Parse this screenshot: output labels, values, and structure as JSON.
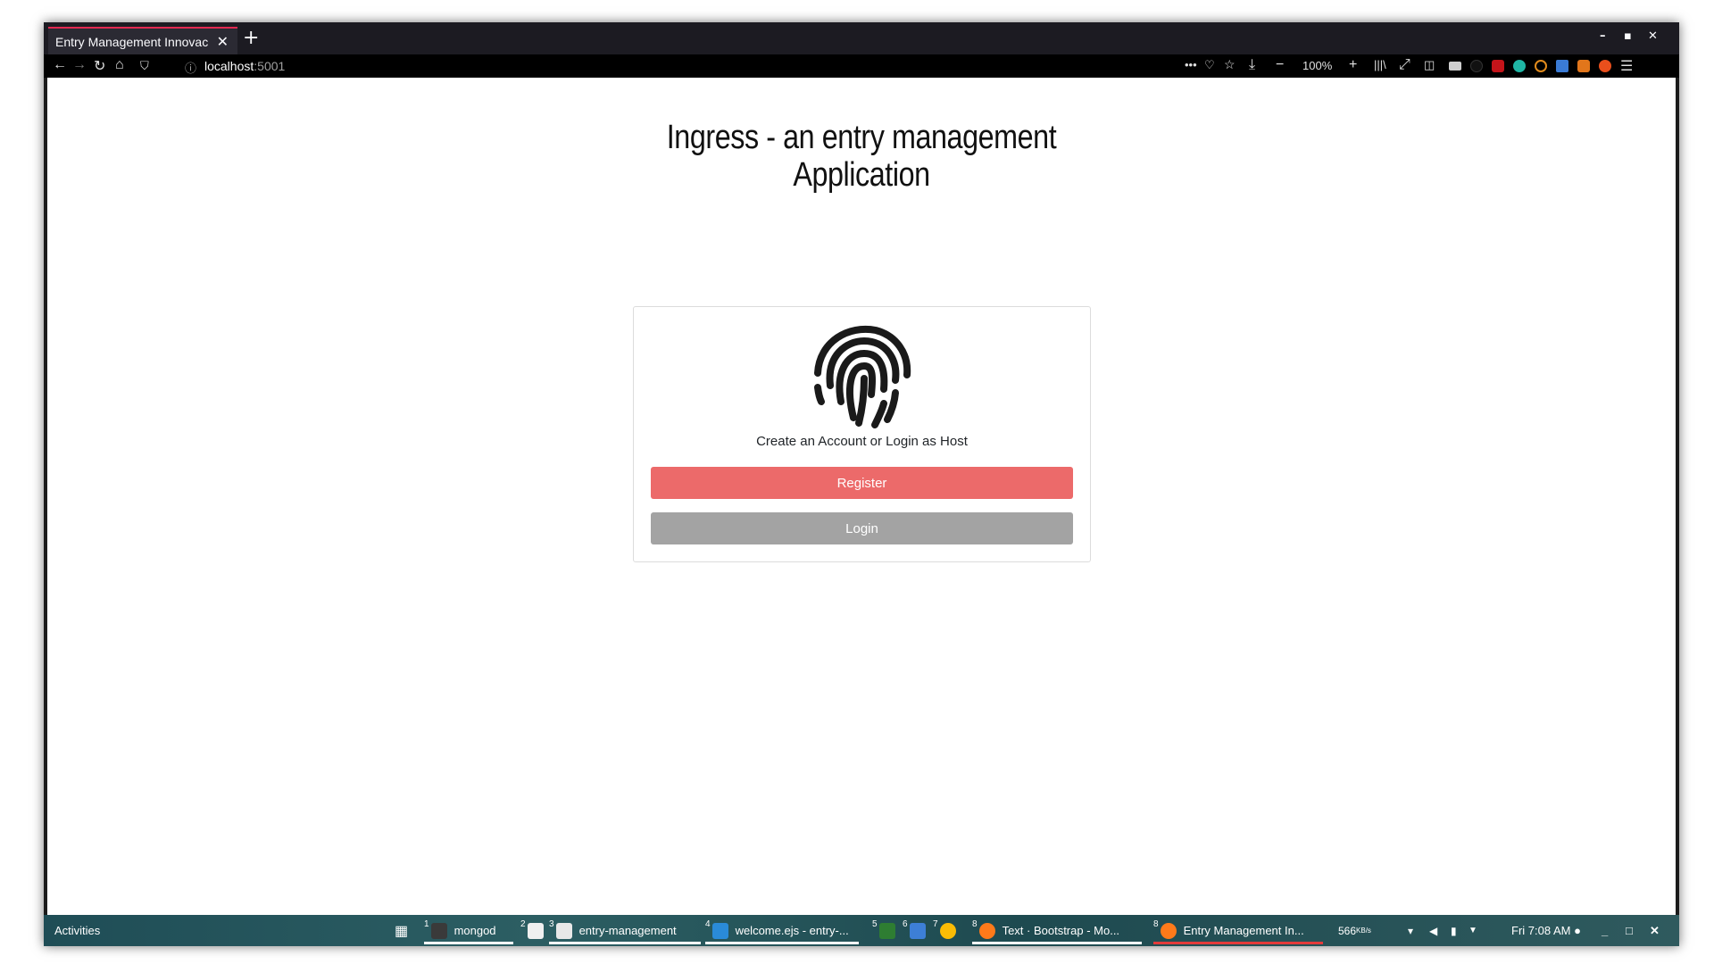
{
  "browser": {
    "tab_title": "Entry Management Innovac",
    "tab_close": "✕",
    "new_tab": "+",
    "window_controls": [
      "–",
      "▪",
      "✕"
    ],
    "url_host": "localhost",
    "url_port": ":5001",
    "zoom": "100%"
  },
  "page": {
    "title_line1": "Ingress - an entry management",
    "title_line2": "Application",
    "card_text": "Create an Account or Login as Host",
    "register_label": "Register",
    "login_label": "Login"
  },
  "taskbar": {
    "activities": "Activities",
    "items": [
      {
        "num": "1",
        "label": "mongod"
      },
      {
        "num": "2",
        "label": ""
      },
      {
        "num": "3",
        "label": "entry-management"
      },
      {
        "num": "4",
        "label": "welcome.ejs - entry-..."
      },
      {
        "num": "5",
        "label": ""
      },
      {
        "num": "6",
        "label": ""
      },
      {
        "num": "7",
        "label": ""
      },
      {
        "num": "8",
        "label": "Text · Bootstrap - Mo..."
      },
      {
        "num": "8",
        "label": "Entry Management In..."
      }
    ],
    "net_speed": "566",
    "net_unit": "KB/s",
    "clock": "Fri  7:08 AM ●",
    "window_controls": [
      "_",
      "□",
      "✕"
    ]
  },
  "colors": {
    "register": "#ec6a6a",
    "login": "#a3a3a3",
    "tab_accent": "#e22850"
  }
}
